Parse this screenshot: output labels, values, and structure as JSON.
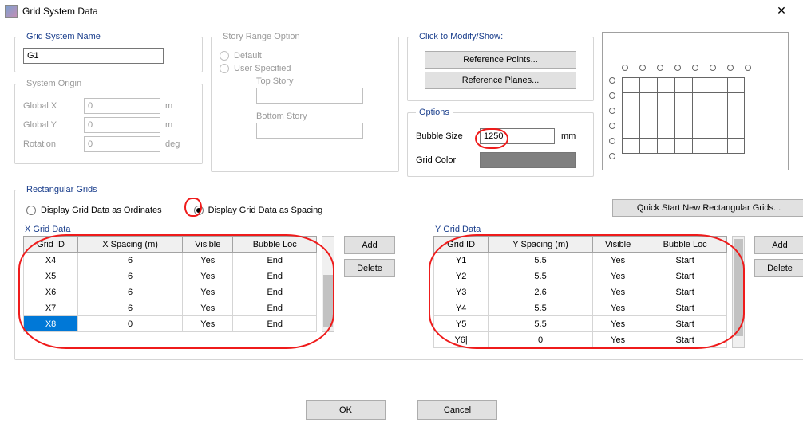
{
  "window": {
    "title": "Grid System Data"
  },
  "grid_system_name": {
    "legend": "Grid System Name",
    "value": "G1"
  },
  "system_origin": {
    "legend": "System Origin",
    "global_x_label": "Global X",
    "global_x": "0",
    "gx_unit": "m",
    "global_y_label": "Global Y",
    "global_y": "0",
    "gy_unit": "m",
    "rotation_label": "Rotation",
    "rotation": "0",
    "rot_unit": "deg"
  },
  "story_range": {
    "legend": "Story Range Option",
    "default": "Default",
    "user_specified": "User Specified",
    "top_story": "Top Story",
    "bottom_story": "Bottom Story"
  },
  "modify": {
    "legend": "Click to Modify/Show:",
    "ref_points": "Reference Points...",
    "ref_planes": "Reference Planes..."
  },
  "options": {
    "legend": "Options",
    "bubble_size_label": "Bubble Size",
    "bubble_size": "1250",
    "bubble_unit": "mm",
    "grid_color_label": "Grid Color",
    "grid_color": "#808080"
  },
  "rect": {
    "legend": "Rectangular Grids",
    "ordinates": "Display Grid Data as Ordinates",
    "spacing": "Display Grid Data as Spacing",
    "quick": "Quick Start New Rectangular Grids..."
  },
  "x_grid": {
    "label": "X Grid Data",
    "headers": [
      "Grid ID",
      "X Spacing  (m)",
      "Visible",
      "Bubble Loc"
    ],
    "rows": [
      {
        "id": "X4",
        "sp": "6",
        "vis": "Yes",
        "bl": "End",
        "sel": false
      },
      {
        "id": "X5",
        "sp": "6",
        "vis": "Yes",
        "bl": "End",
        "sel": false
      },
      {
        "id": "X6",
        "sp": "6",
        "vis": "Yes",
        "bl": "End",
        "sel": false
      },
      {
        "id": "X7",
        "sp": "6",
        "vis": "Yes",
        "bl": "End",
        "sel": false
      },
      {
        "id": "X8",
        "sp": "0",
        "vis": "Yes",
        "bl": "End",
        "sel": true
      }
    ]
  },
  "y_grid": {
    "label": "Y Grid Data",
    "headers": [
      "Grid ID",
      "Y Spacing  (m)",
      "Visible",
      "Bubble Loc"
    ],
    "rows": [
      {
        "id": "Y1",
        "sp": "5.5",
        "vis": "Yes",
        "bl": "Start",
        "sel": false
      },
      {
        "id": "Y2",
        "sp": "5.5",
        "vis": "Yes",
        "bl": "Start",
        "sel": false
      },
      {
        "id": "Y3",
        "sp": "2.6",
        "vis": "Yes",
        "bl": "Start",
        "sel": false
      },
      {
        "id": "Y4",
        "sp": "5.5",
        "vis": "Yes",
        "bl": "Start",
        "sel": false
      },
      {
        "id": "Y5",
        "sp": "5.5",
        "vis": "Yes",
        "bl": "Start",
        "sel": false
      },
      {
        "id": "Y6|",
        "sp": "0",
        "vis": "Yes",
        "bl": "Start",
        "sel": false
      }
    ]
  },
  "btn": {
    "add": "Add",
    "delete": "Delete",
    "ok": "OK",
    "cancel": "Cancel"
  }
}
